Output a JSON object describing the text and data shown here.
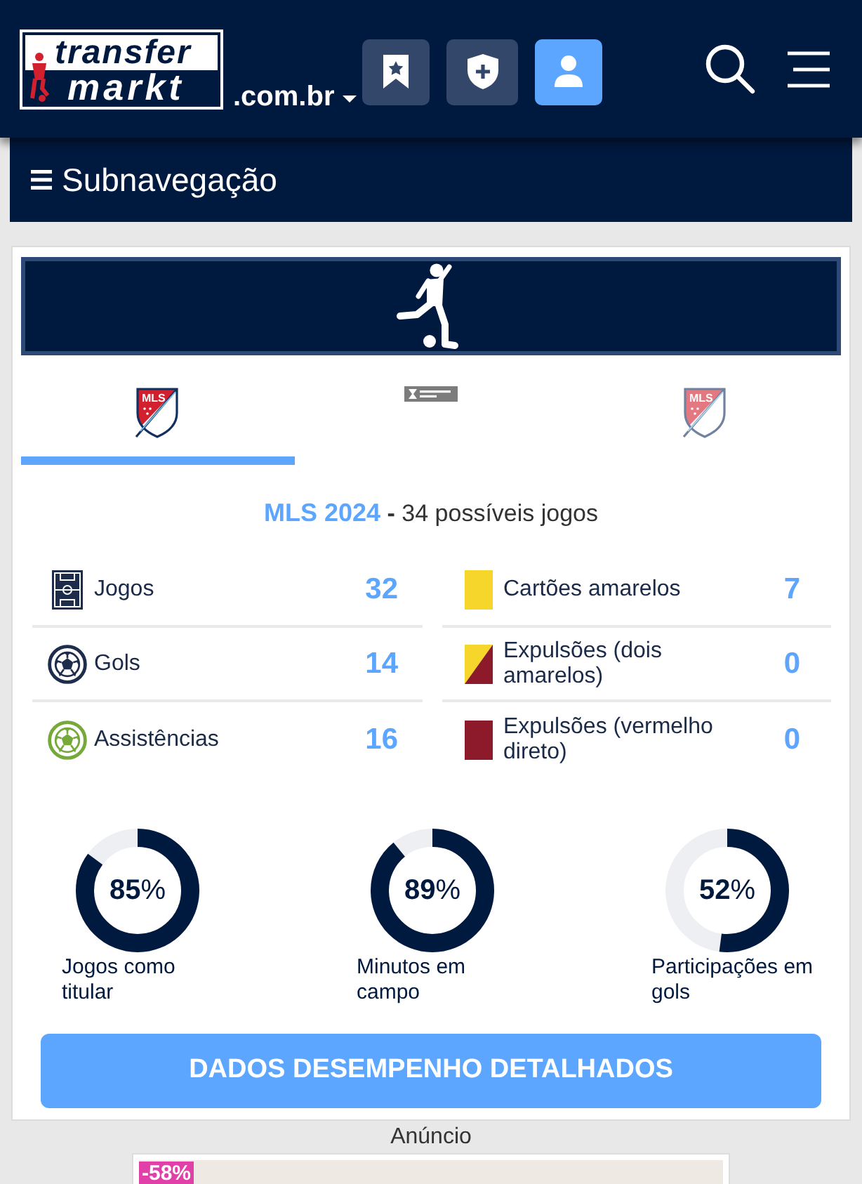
{
  "header": {
    "logo": {
      "top": "transfer",
      "bottom": "markt"
    },
    "domain": ".com.br",
    "buttons": [
      {
        "kind": "bookmark"
      },
      {
        "kind": "shield"
      },
      {
        "kind": "user"
      }
    ]
  },
  "subnav": {
    "label": "Subnavegação"
  },
  "competition_tabs": [
    {
      "kind": "mls",
      "logo_text": "MLS",
      "selected": true
    },
    {
      "kind": "leagues_cup",
      "selected": false
    },
    {
      "kind": "mls",
      "logo_text": "MLS",
      "selected": false
    }
  ],
  "season": {
    "competition": "MLS 2024",
    "separator": "-",
    "note": "34 possíveis jogos"
  },
  "stats_left": [
    {
      "kind": "appearances",
      "label": "Jogos",
      "value": "32"
    },
    {
      "kind": "goals",
      "label": "Gols",
      "value": "14"
    },
    {
      "kind": "assists",
      "label": "Assistências",
      "value": "16"
    }
  ],
  "stats_right": [
    {
      "kind": "yellow_card",
      "label": "Cartões amarelos",
      "value": "7"
    },
    {
      "kind": "second_yellow",
      "label": "Expulsões (dois amarelos)",
      "value": "0"
    },
    {
      "kind": "red_card",
      "label": "Expulsões (vermelho direto)",
      "value": "0"
    }
  ],
  "rates": [
    {
      "reading": "**85**%",
      "label": "Jogos como titular",
      "level": 0.85
    },
    {
      "reading": "**89**%",
      "label": "Minutos em campo",
      "level": 0.89
    },
    {
      "reading": "**52**%",
      "label": "Participações em gols",
      "level": 0.52
    }
  ],
  "details_button": "DADOS DESEMPENHO DETALHADOS",
  "ad": {
    "label": "Anúncio",
    "badge": "-58%"
  }
}
